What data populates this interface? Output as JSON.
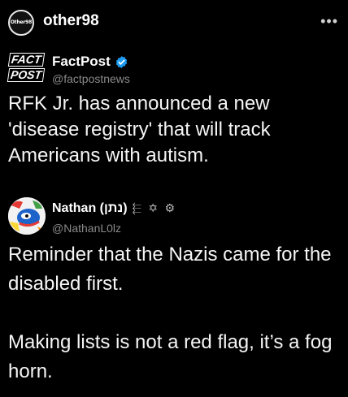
{
  "header": {
    "avatar_text": "Other98",
    "username": "other98",
    "more_icon": "more-horizontal-icon"
  },
  "post1": {
    "logo_line1": "FACT",
    "logo_line2": "POST",
    "display_name": "FactPost",
    "handle": "@factpostnews",
    "verified_color": "#1d9bf0",
    "body": "RFK Jr. has announced a new 'disease registry' that will track Americans with autism."
  },
  "post2": {
    "display_name": "Nathan (נתן)",
    "name_emoji": "⬱ ✡ ⚙",
    "handle": "@NathanL0lz",
    "body_paragraph1": "Reminder that the Nazis came for the disabled first.",
    "body_paragraph2": "Making lists is not a red flag, it’s a fog horn."
  }
}
